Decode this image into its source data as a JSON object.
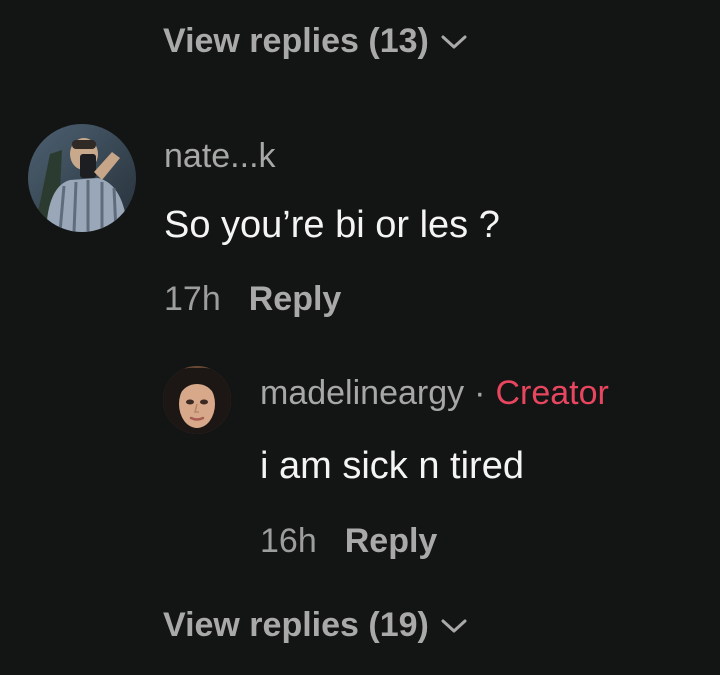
{
  "thread": {
    "view_replies_top": "View replies (13)",
    "view_replies_bottom": "View replies (19)"
  },
  "comment": {
    "username": "nate...k",
    "text": "So you’re bi or les ?",
    "timestamp": "17h",
    "reply_label": "Reply",
    "avatar_icon": "profile-photo-icon"
  },
  "reply": {
    "username": "madelineargy",
    "separator": "·",
    "badge": "Creator",
    "text": "i am sick n tired",
    "timestamp": "16h",
    "reply_label": "Reply",
    "avatar_icon": "profile-photo-icon"
  },
  "colors": {
    "background": "#131515",
    "primary_text": "#f4f4f4",
    "secondary_text": "#a9a9aa",
    "creator_badge": "#e8455e"
  }
}
